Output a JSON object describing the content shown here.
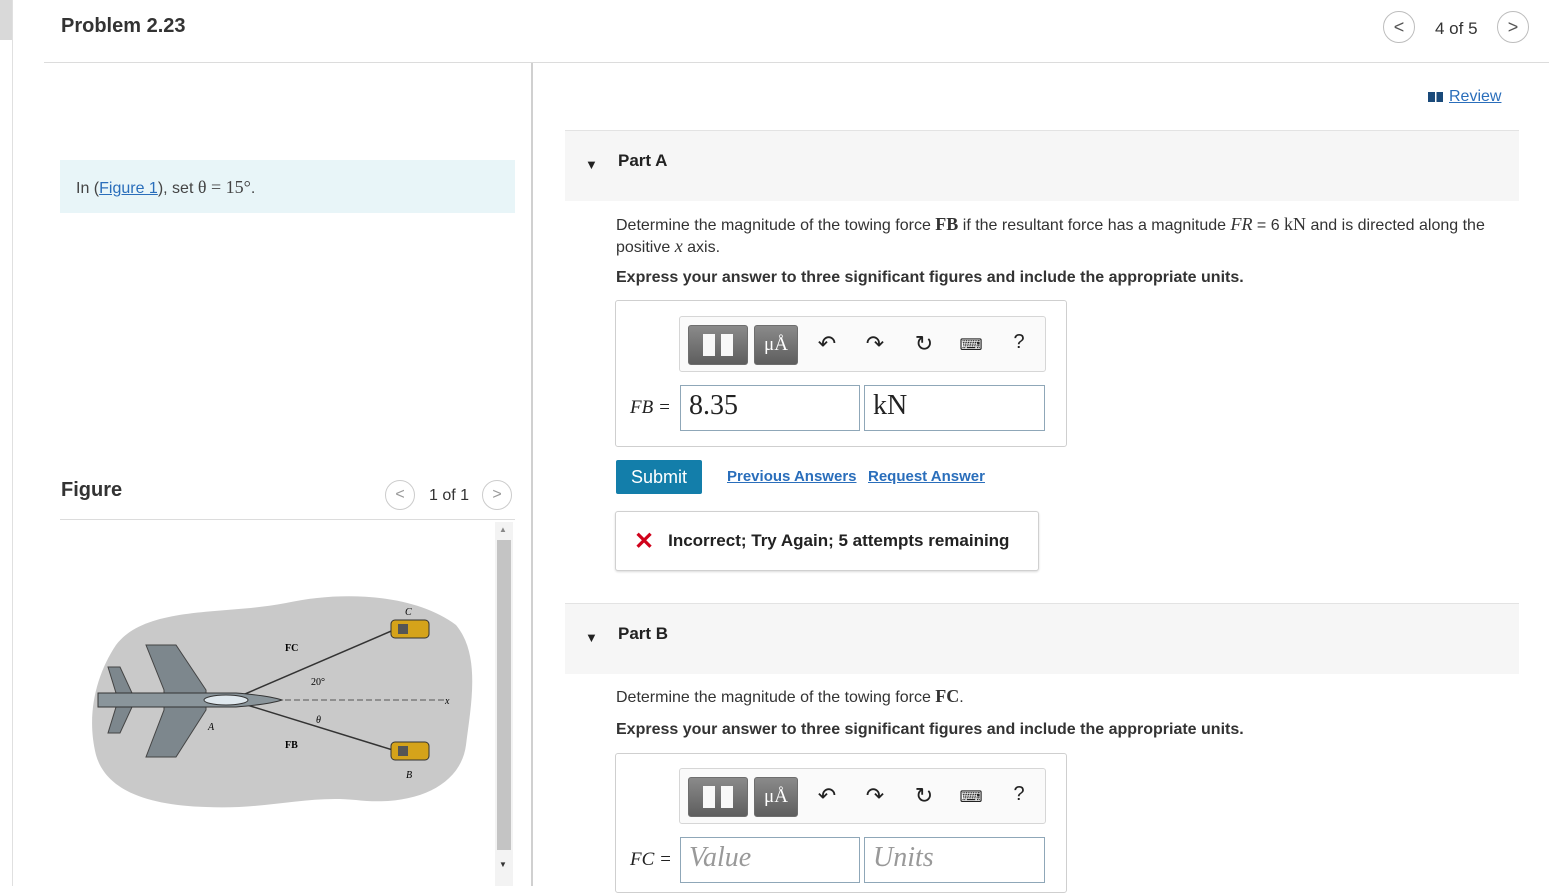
{
  "header": {
    "title": "Problem 2.23",
    "counter": "4 of 5",
    "prev": "<",
    "next": ">"
  },
  "intro": {
    "prefix": "In (",
    "link": "Figure 1",
    "suffix": "), set ",
    "math": "θ = 15°",
    "end": "."
  },
  "figure": {
    "heading": "Figure",
    "counter": "1 of 1",
    "labels": {
      "fc": "FC",
      "fb": "FB",
      "angle20": "20°",
      "theta": "θ",
      "a": "A",
      "b": "B",
      "c": "C",
      "x": "x"
    }
  },
  "review": {
    "label": "Review"
  },
  "partA": {
    "label": "Part A",
    "q_pre": "Determine the magnitude of the towing force ",
    "q_fb": "FB",
    "q_mid": " if the resultant force has a magnitude ",
    "q_fr": "FR",
    "q_val": " = 6 ",
    "q_unit": "kN",
    "q_post": " and is directed along the",
    "q_line2a": "positive ",
    "q_x": "x",
    "q_line2b": " axis.",
    "express": "Express your answer to three significant figures and include the appropriate units.",
    "eq_label": "FB =",
    "value": "8.35",
    "units": "kN",
    "submit": "Submit",
    "prev_answers": "Previous Answers",
    "request_answer": "Request Answer",
    "feedback": "Incorrect; Try Again; 5 attempts remaining"
  },
  "partB": {
    "label": "Part B",
    "q_pre": "Determine the magnitude of the towing force ",
    "q_fc": "FC",
    "q_post": ".",
    "express": "Express your answer to three significant figures and include the appropriate units.",
    "eq_label": "FC =",
    "value_placeholder": "Value",
    "units_placeholder": "Units"
  },
  "toolbar": {
    "mu": "μÅ",
    "help": "?"
  }
}
